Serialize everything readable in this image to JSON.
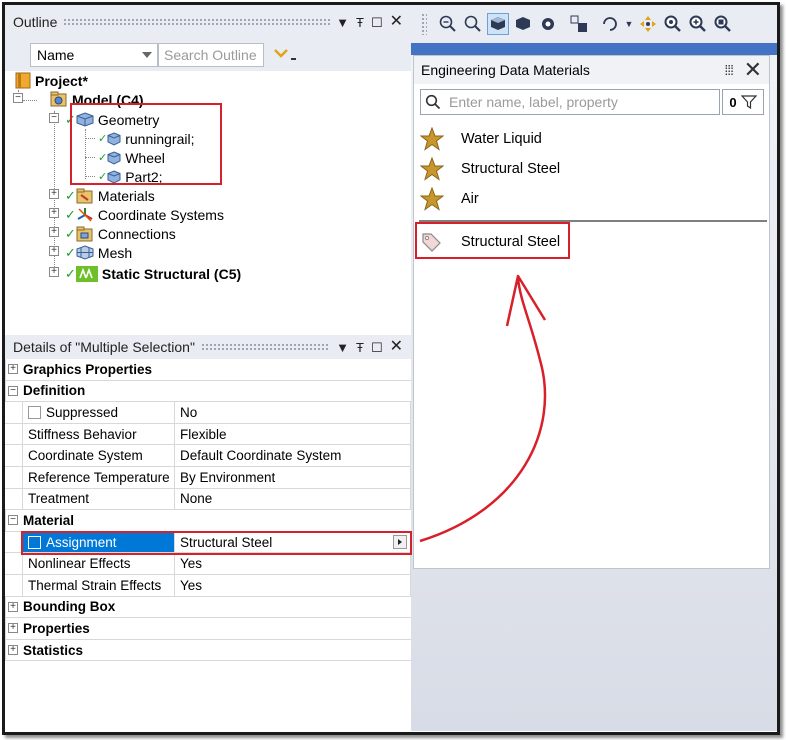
{
  "outline": {
    "title": "Outline",
    "pin": "Ŧ",
    "dock": "☐",
    "close": "✕",
    "name_select": "Name",
    "search_placeholder": "Search Outline",
    "tree": {
      "project": "Project*",
      "model": "Model (C4)",
      "geometry": "Geometry",
      "geometry_children": [
        "runningrail;",
        "Wheel",
        "Part2;"
      ],
      "materials": "Materials",
      "coordinate_systems": "Coordinate Systems",
      "connections": "Connections",
      "mesh": "Mesh",
      "static_structural": "Static Structural (C5)"
    }
  },
  "details": {
    "title": "Details of \"Multiple Selection\"",
    "categories": {
      "graphics": "Graphics Properties",
      "definition": "Definition",
      "material": "Material",
      "bounding_box": "Bounding Box",
      "properties": "Properties",
      "statistics": "Statistics"
    },
    "definition_rows": [
      {
        "key": "Suppressed",
        "value": "No"
      },
      {
        "key": "Stiffness Behavior",
        "value": "Flexible"
      },
      {
        "key": "Coordinate System",
        "value": "Default Coordinate System"
      },
      {
        "key": "Reference Temperature",
        "value": "By Environment"
      },
      {
        "key": "Treatment",
        "value": "None"
      }
    ],
    "material_rows": [
      {
        "key": "Assignment",
        "value": "Structural Steel"
      },
      {
        "key": "Nonlinear Effects",
        "value": "Yes"
      },
      {
        "key": "Thermal Strain Effects",
        "value": "Yes"
      }
    ]
  },
  "engineering_data": {
    "title": "Engineering Data Materials",
    "tools": "⁞⁞⁞",
    "close": "✕",
    "search_placeholder": "Enter name, label, property",
    "filter_count": "0",
    "favorites": [
      "Water Liquid",
      "Structural Steel",
      "Air"
    ],
    "assigned": "Structural Steel"
  },
  "colors": {
    "highlight_red": "#d8202b",
    "selection_blue": "#0078d7",
    "star": "#c8962a",
    "check_green": "#1e9c2e"
  }
}
